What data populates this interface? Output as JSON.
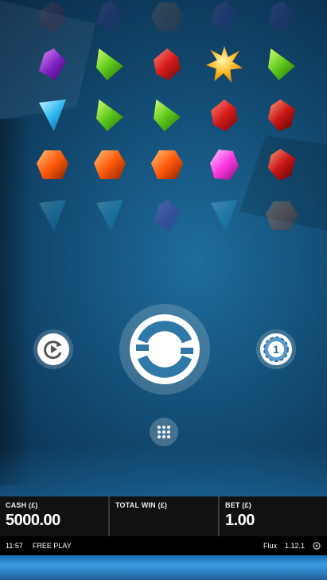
{
  "reels": {
    "rows": [
      [
        "red",
        "purple",
        "orange",
        "purple",
        "purple"
      ],
      [
        "purple",
        "green",
        "red",
        "star",
        "green"
      ],
      [
        "blue",
        "green",
        "green",
        "red",
        "darkred"
      ],
      [
        "orange",
        "orange",
        "orange",
        "pink",
        "darkred"
      ],
      [
        "blue",
        "blue",
        "purple",
        "blue",
        "orange"
      ]
    ]
  },
  "controls": {
    "autoplay_icon": "autoplay-icon",
    "spin_icon": "spin-icon",
    "coin_value": "1",
    "menu_icon": "grid-menu-icon"
  },
  "bar": {
    "cash_label": "CASH (£)",
    "cash_value": "5000.00",
    "win_label": "TOTAL WIN (£)",
    "win_value": "",
    "bet_label": "BET (£)",
    "bet_value": "1.00"
  },
  "status": {
    "time": "11:57",
    "mode": "FREE PLAY",
    "game_name": "Flux",
    "version": "1.12.1"
  }
}
